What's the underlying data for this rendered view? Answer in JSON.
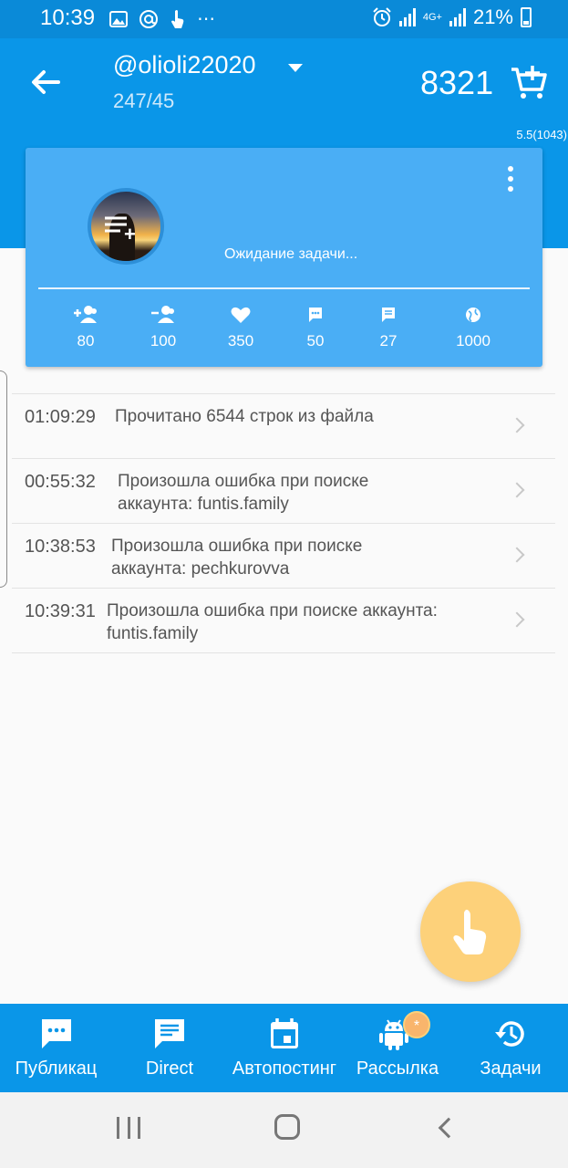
{
  "status_bar": {
    "time": "10:39",
    "network": "4G+",
    "battery": "21%",
    "more": "⋯",
    "icons": [
      "image-icon",
      "at-icon",
      "touch-icon",
      "alarm-icon",
      "signal-icon",
      "signal-icon",
      "battery-icon"
    ]
  },
  "header": {
    "account": "@olioli22020",
    "stats": "247/45",
    "balance": "8321",
    "version": "5.5(1043)"
  },
  "card": {
    "status": "Ожидание задачи...",
    "stats": [
      {
        "icon": "follow-add-icon",
        "value": "80"
      },
      {
        "icon": "unfollow-icon",
        "value": "100"
      },
      {
        "icon": "like-icon",
        "value": "350"
      },
      {
        "icon": "comment-icon",
        "value": "50"
      },
      {
        "icon": "direct-message-icon",
        "value": "27"
      },
      {
        "icon": "globe-icon",
        "value": "1000"
      }
    ]
  },
  "log": [
    {
      "time": "01:09:29",
      "line1": "Прочитано 6544 строк из файла",
      "line2": ""
    },
    {
      "time": "00:55:32",
      "line1": "Произошла ошибка при поиске",
      "line2": "аккаунта: funtis.family"
    },
    {
      "time": "10:38:53",
      "line1": "Произошла ошибка при поиске",
      "line2": "аккаунта: pechkurovva"
    },
    {
      "time": "10:39:31",
      "line1": "Произошла ошибка при поиске аккаунта:",
      "line2": "funtis.family"
    }
  ],
  "bottom_nav": [
    {
      "label": "Публикац",
      "icon": "chat-dots-icon"
    },
    {
      "label": "Direct",
      "icon": "message-icon"
    },
    {
      "label": "Автопостинг",
      "icon": "calendar-icon"
    },
    {
      "label": "Рассылка",
      "icon": "android-icon",
      "badge": "*"
    },
    {
      "label": "Задачи",
      "icon": "history-icon"
    }
  ],
  "colors": {
    "primary": "#0a96e8",
    "card": "#4aaef5",
    "fab": "#fdd17a",
    "badge": "#f9b56c"
  }
}
